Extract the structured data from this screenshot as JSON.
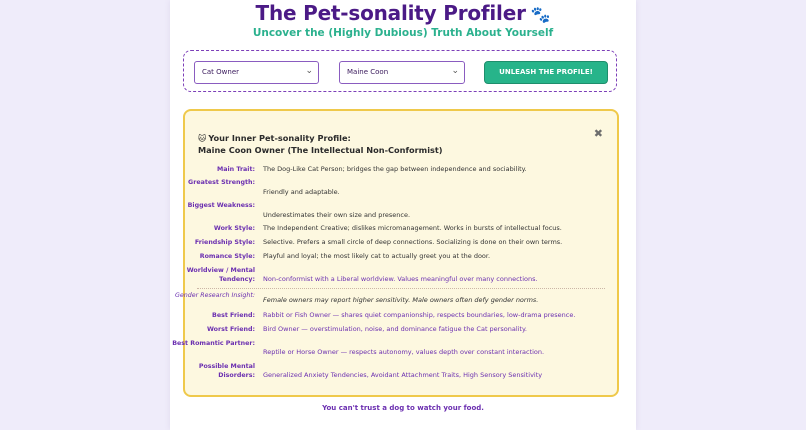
{
  "header": {
    "title": "The Pet-sonality Profiler",
    "title_icon": "paw-prints",
    "subtitle": "Uncover the (Highly Dubious) Truth About Yourself"
  },
  "controls": {
    "owner_select_value": "Cat Owner",
    "breed_select_value": "Maine Coon",
    "submit_label": "UNLEASH THE PROFILE!"
  },
  "result": {
    "heading_emoji": "🐱",
    "heading": "Your Inner Pet-sonality Profile:",
    "subheading": "Maine Coon Owner (The Intellectual Non-Conformist)",
    "close_label": "✖",
    "rows": [
      {
        "label": "Main Trait:",
        "value": "The Dog-Like Cat Person; bridges the gap between independence and sociability."
      },
      {
        "label": "Greatest Strength:",
        "value": "Friendly and adaptable."
      },
      {
        "label": "Biggest Weakness:",
        "value": "Underestimates their own size and presence."
      },
      {
        "label": "Work Style:",
        "value": "The Independent Creative; dislikes micromanagement. Works in bursts of intellectual focus."
      },
      {
        "label": "Friendship Style:",
        "value": "Selective. Prefers a small circle of deep connections. Socializing is done on their own terms."
      },
      {
        "label": "Romance Style:",
        "value": "Playful and loyal; the most likely cat to actually greet you at the door."
      },
      {
        "label": "Worldview / Mental Tendency:",
        "value": "Non-conformist with a Liberal worldview. Values meaningful over many connections."
      },
      {
        "label": "Gender Research Insight:",
        "value": "Female owners may report higher sensitivity. Male owners often defy gender norms."
      },
      {
        "label": "Best Friend:",
        "value": "Rabbit or Fish Owner — shares quiet companionship, respects boundaries, low-drama presence."
      },
      {
        "label": "Worst Friend:",
        "value": "Bird Owner — overstimulation, noise, and dominance fatigue the Cat personality."
      },
      {
        "label": "Best Romantic Partner:",
        "value": "Reptile or Horse Owner — respects autonomy, values depth over constant interaction."
      },
      {
        "label": "Possible Mental Disorders:",
        "value": "Generalized Anxiety Tendencies, Avoidant Attachment Traits, High Sensory Sensitivity"
      }
    ]
  },
  "footer": {
    "text": "You can't trust a dog to watch your food."
  },
  "colors": {
    "title": "#4b1a86",
    "subtitle": "#2bb18e",
    "label_purple": "#6b2fb0",
    "button": "#27b48a",
    "result_border": "#efc94b",
    "result_bg": "#fdf8e0"
  }
}
